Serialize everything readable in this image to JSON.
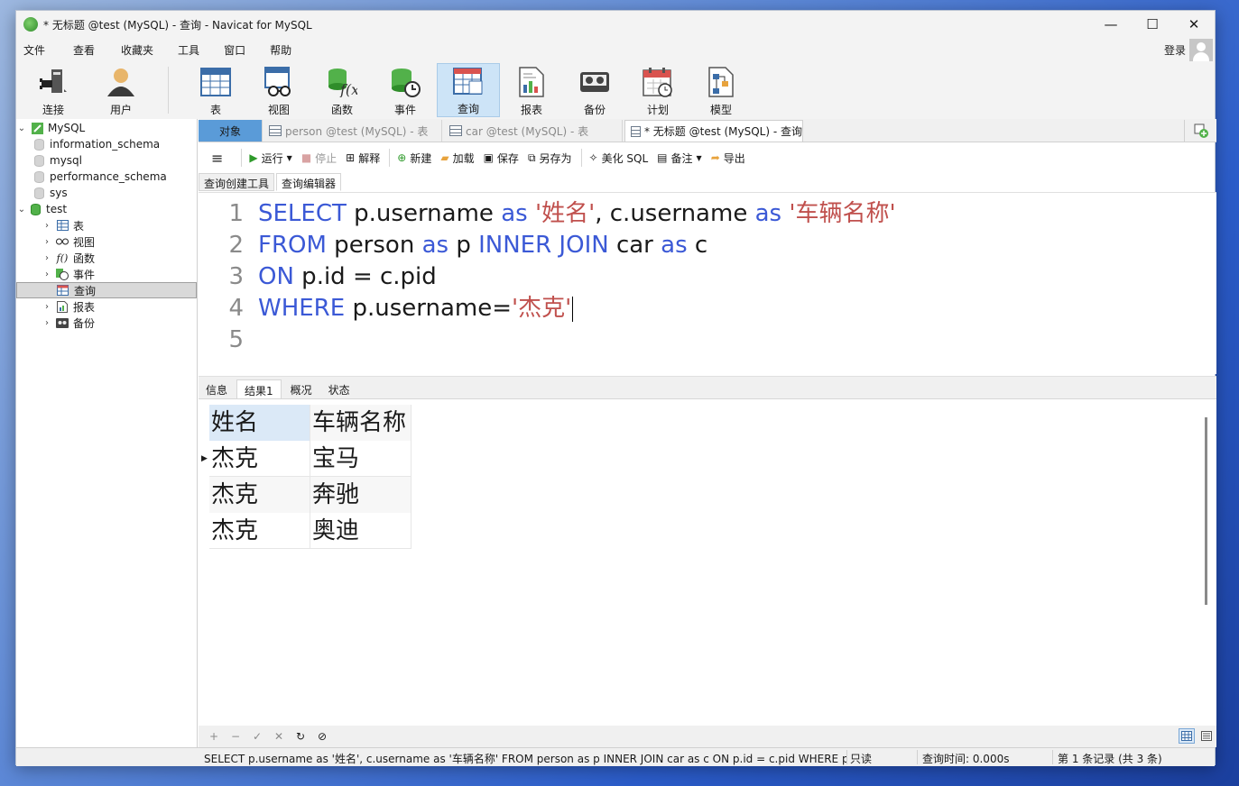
{
  "window": {
    "title": "* 无标题 @test (MySQL) - 查询 - Navicat for MySQL",
    "minimize": "—",
    "maximize": "☐",
    "close": "✕"
  },
  "menu": [
    "文件",
    "查看",
    "收藏夹",
    "工具",
    "窗口",
    "帮助"
  ],
  "login": "登录",
  "toolbar": [
    "连接",
    "用户",
    "表",
    "视图",
    "函数",
    "事件",
    "查询",
    "报表",
    "备份",
    "计划",
    "模型"
  ],
  "active_toolbar": "查询",
  "sidebar": {
    "connection": "MySQL",
    "databases": [
      "information_schema",
      "mysql",
      "performance_schema",
      "sys",
      "test"
    ],
    "test_children": [
      "表",
      "视图",
      "函数",
      "事件",
      "查询",
      "报表",
      "备份"
    ],
    "selected": "查询"
  },
  "tabs": {
    "objects": "对象",
    "items": [
      "person @test (MySQL) - 表",
      "car @test (MySQL) - 表",
      "* 无标题 @test (MySQL) - 查询"
    ]
  },
  "query_toolbar": {
    "run": "运行",
    "stop": "停止",
    "explain": "解释",
    "new": "新建",
    "load": "加载",
    "save": "保存",
    "save_as": "另存为",
    "beautify": "美化 SQL",
    "comment": "备注",
    "export": "导出"
  },
  "editor_tabs": [
    "查询创建工具",
    "查询编辑器"
  ],
  "editor": {
    "line_numbers": [
      "1",
      "2",
      "3",
      "4",
      "5"
    ],
    "lines": [
      [
        {
          "t": "SELECT",
          "c": "kw"
        },
        {
          "t": " p.username ",
          "c": ""
        },
        {
          "t": "as",
          "c": "kw"
        },
        {
          "t": " ",
          "c": ""
        },
        {
          "t": "'姓名'",
          "c": "st"
        },
        {
          "t": ", c.username ",
          "c": ""
        },
        {
          "t": "as",
          "c": "kw"
        },
        {
          "t": " ",
          "c": ""
        },
        {
          "t": "'车辆名称'",
          "c": "st"
        }
      ],
      [
        {
          "t": "FROM",
          "c": "kw"
        },
        {
          "t": " person ",
          "c": ""
        },
        {
          "t": "as",
          "c": "kw"
        },
        {
          "t": " p ",
          "c": ""
        },
        {
          "t": "INNER JOIN",
          "c": "kw"
        },
        {
          "t": " car ",
          "c": ""
        },
        {
          "t": "as",
          "c": "kw"
        },
        {
          "t": " c",
          "c": ""
        }
      ],
      [
        {
          "t": "ON",
          "c": "kw"
        },
        {
          "t": " p.id = c.pid",
          "c": ""
        }
      ],
      [
        {
          "t": "WHERE",
          "c": "kw"
        },
        {
          "t": " p.username=",
          "c": ""
        },
        {
          "t": "'杰克'",
          "c": "st"
        }
      ],
      []
    ]
  },
  "result_tabs": [
    "信息",
    "结果1",
    "概况",
    "状态"
  ],
  "result": {
    "columns": [
      "姓名",
      "车辆名称"
    ],
    "rows": [
      [
        "杰克",
        "宝马"
      ],
      [
        "杰克",
        "奔驰"
      ],
      [
        "杰克",
        "奥迪"
      ]
    ]
  },
  "grid_buttons": [
    "+",
    "−",
    "✓",
    "✕",
    "↻",
    "⊘"
  ],
  "status": {
    "sql": "SELECT p.username as '姓名', c.username as '车辆名称' FROM person as p INNER JOIN car as c ON p.id = c.pid WHERE p.",
    "mode": "只读",
    "time": "查询时间: 0.000s",
    "records": "第 1 条记录 (共 3 条)"
  },
  "colors": {
    "keyword": "#3b59d6",
    "string": "#c0504d",
    "active_tab": "#5a9bd8"
  }
}
